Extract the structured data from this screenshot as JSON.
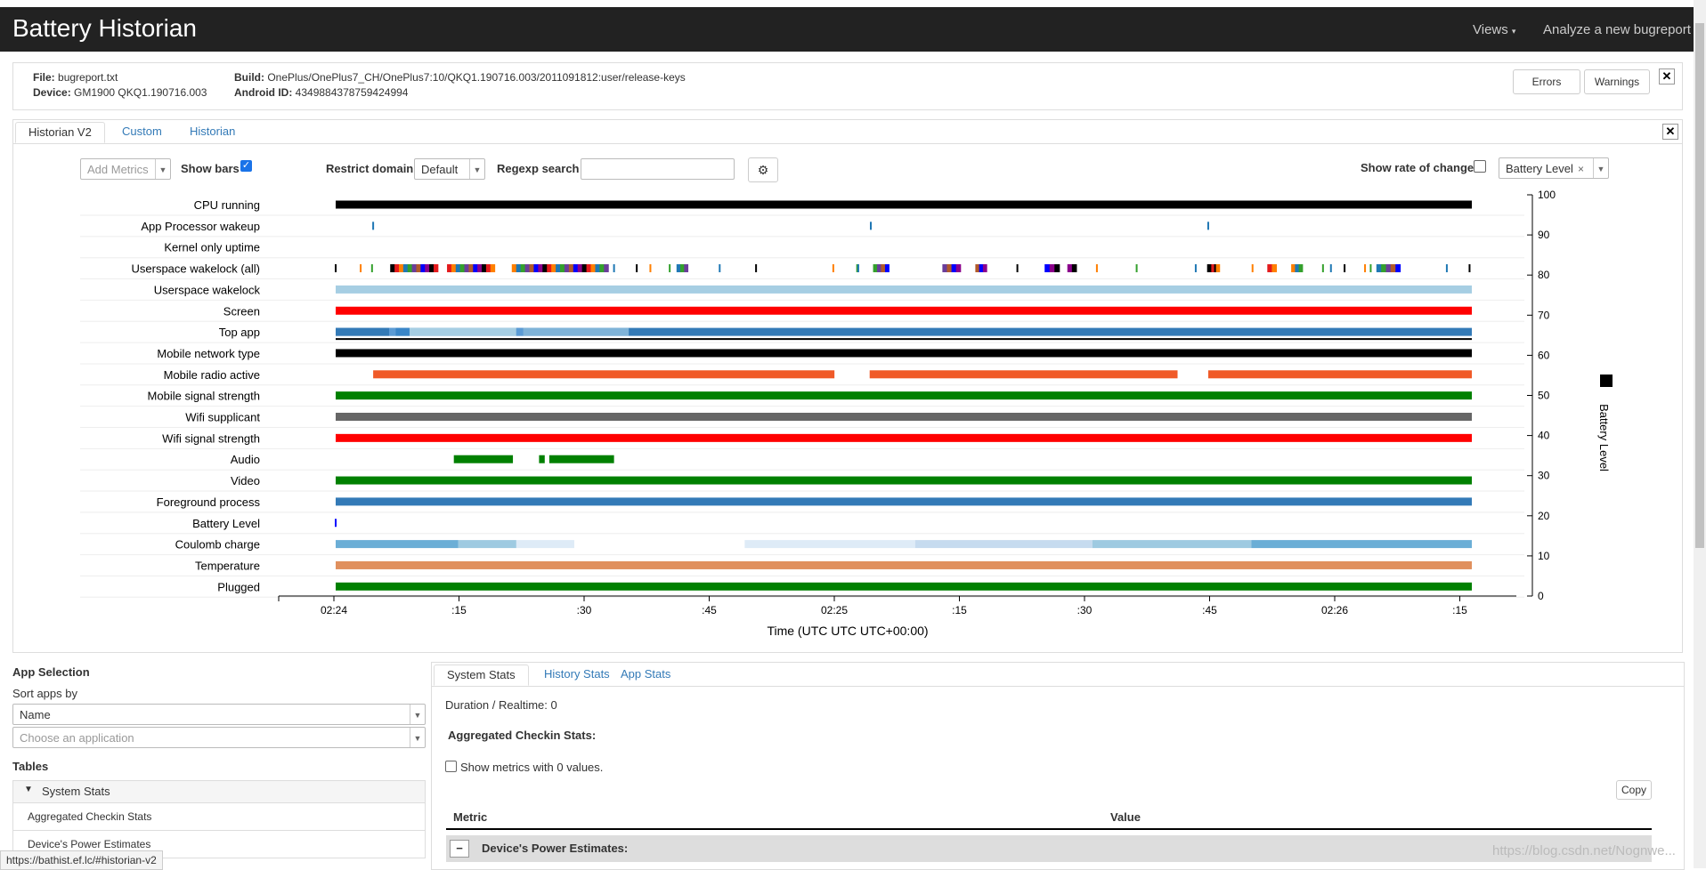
{
  "header": {
    "title": "Battery Historian",
    "views_label": "Views",
    "analyze_label": "Analyze a new bugreport"
  },
  "info": {
    "file_label": "File:",
    "file_value": "bugreport.txt",
    "device_label": "Device:",
    "device_value": "GM1900 QKQ1.190716.003",
    "build_label": "Build:",
    "build_value": "OnePlus/OnePlus7_CH/OnePlus7:10/QKQ1.190716.003/2011091812:user/release-keys",
    "android_id_label": "Android ID:",
    "android_id_value": "4349884378759424994",
    "errors_button": "Errors",
    "warnings_button": "Warnings"
  },
  "tabs": [
    "Historian V2",
    "Custom",
    "Historian"
  ],
  "controls": {
    "add_metrics": "Add Metrics",
    "show_bars_label": "Show bars",
    "restrict_domain_label": "Restrict domain",
    "restrict_domain_value": "Default",
    "regexp_label": "Regexp search",
    "regexp_value": "",
    "show_rate_label": "Show rate of change",
    "battery_level_tag": "Battery Level",
    "gear_icon": "gear-icon"
  },
  "chart_data": {
    "type": "timeline",
    "xlabel": "Time (UTC UTC UTC+00:00)",
    "x_ticks": [
      "02:24",
      ":15",
      ":30",
      ":45",
      "02:25",
      ":15",
      ":30",
      ":45",
      "02:26",
      ":15"
    ],
    "ylabel_right": "Battery Level",
    "y_right_ticks": [
      100,
      90,
      80,
      70,
      60,
      50,
      40,
      30,
      20,
      10,
      0
    ],
    "y_range": [
      0,
      100
    ],
    "legend": "Battery Level",
    "rows": [
      {
        "label": "CPU running",
        "color": "#000000",
        "segments": [
          [
            0,
            1
          ]
        ]
      },
      {
        "label": "App Processor wakeup",
        "color": "#1f77b4",
        "marks": [
          0.033,
          0.471,
          0.768
        ]
      },
      {
        "label": "Kernel only uptime",
        "color": "#000000",
        "segments": []
      },
      {
        "label": "Userspace wakelock (all)",
        "color": "#mixed",
        "segments": [
          [
            0.048,
            0.09
          ],
          [
            0.098,
            0.14
          ],
          [
            0.155,
            0.24
          ],
          [
            0.3,
            0.31
          ],
          [
            0.473,
            0.487
          ],
          [
            0.534,
            0.55
          ],
          [
            0.563,
            0.573
          ],
          [
            0.624,
            0.637
          ],
          [
            0.644,
            0.652
          ],
          [
            0.767,
            0.778
          ],
          [
            0.82,
            0.828
          ],
          [
            0.841,
            0.851
          ],
          [
            0.916,
            0.937
          ]
        ],
        "marks": [
          0.0,
          0.022,
          0.032,
          0.245,
          0.265,
          0.277,
          0.294,
          0.338,
          0.37,
          0.438,
          0.459,
          0.46,
          0.6,
          0.67,
          0.705,
          0.757,
          0.774,
          0.807,
          0.869,
          0.876,
          0.888,
          0.906,
          0.911,
          0.978,
          0.998
        ]
      },
      {
        "label": "Userspace wakelock",
        "color": "#a6cee3",
        "segments": [
          [
            0,
            1
          ]
        ]
      },
      {
        "label": "Screen",
        "color": "#ff0000",
        "segments": [
          [
            0,
            1
          ]
        ]
      },
      {
        "label": "Top app",
        "color": "#mixed",
        "segments": [
          [
            0,
            1
          ]
        ]
      },
      {
        "label": "Mobile network type",
        "color": "#000000",
        "segments": [
          [
            0,
            1
          ]
        ]
      },
      {
        "label": "Mobile radio active",
        "color": "#f05a28",
        "segments": [
          [
            0.033,
            0.439
          ],
          [
            0.47,
            0.741
          ],
          [
            0.768,
            1
          ]
        ]
      },
      {
        "label": "Mobile signal strength",
        "color": "#008000",
        "segments": [
          [
            0,
            1
          ]
        ]
      },
      {
        "label": "Wifi supplicant",
        "color": "#666666",
        "segments": [
          [
            0,
            1
          ]
        ]
      },
      {
        "label": "Wifi signal strength",
        "color": "#ff0000",
        "segments": [
          [
            0,
            1
          ]
        ]
      },
      {
        "label": "Audio",
        "color": "#008000",
        "segments": [
          [
            0.104,
            0.156
          ],
          [
            0.179,
            0.184
          ],
          [
            0.188,
            0.245
          ]
        ]
      },
      {
        "label": "Video",
        "color": "#008000",
        "segments": [
          [
            0,
            1
          ]
        ]
      },
      {
        "label": "Foreground process",
        "color": "#337ab7",
        "segments": [
          [
            0,
            1
          ]
        ]
      },
      {
        "label": "Battery Level",
        "color": "#0000ff",
        "marks": [
          0.0
        ]
      },
      {
        "label": "Coulomb charge",
        "color": "#mixed",
        "segments": [
          [
            0,
            0.108
          ],
          [
            0.108,
            0.159
          ],
          [
            0.159,
            0.21
          ],
          [
            0.36,
            0.51
          ],
          [
            0.51,
            0.666
          ],
          [
            0.666,
            0.806
          ],
          [
            0.806,
            1
          ]
        ]
      },
      {
        "label": "Temperature",
        "color": "#e0905e",
        "segments": [
          [
            0,
            1
          ]
        ]
      },
      {
        "label": "Plugged",
        "color": "#008000",
        "segments": [
          [
            0,
            1
          ]
        ]
      }
    ]
  },
  "app_selection": {
    "title": "App Selection",
    "sort_label": "Sort apps by",
    "sort_value": "Name",
    "choose_placeholder": "Choose an application",
    "tables_title": "Tables",
    "system_stats_header": "System Stats",
    "items": [
      "Aggregated Checkin Stats",
      "Device's Power Estimates"
    ]
  },
  "stats": {
    "tabs": [
      "System Stats",
      "History Stats",
      "App Stats"
    ],
    "duration": "Duration / Realtime: 0",
    "aggregated_title": "Aggregated Checkin Stats:",
    "show_zero_label": "Show metrics with 0 values.",
    "copy_button": "Copy",
    "col_metric": "Metric",
    "col_value": "Value",
    "section_title": "Device's Power Estimates:",
    "collapse_symbol": "−"
  },
  "statusbar": "https://bathist.ef.lc/#historian-v2",
  "watermark": "https://blog.csdn.net/Nognwe..."
}
